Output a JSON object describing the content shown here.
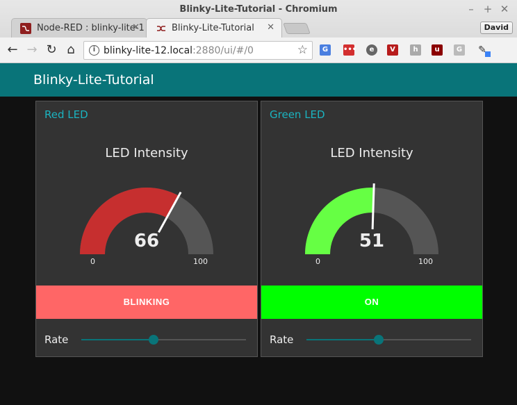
{
  "browser": {
    "window_title": "Blinky-Lite-Tutorial - Chromium",
    "tabs": [
      {
        "label": "Node-RED : blinky-lite-1"
      },
      {
        "label": "Blinky-Lite-Tutorial"
      }
    ],
    "profile_name": "David",
    "url_host": "blinky-lite-12.local",
    "url_path": ":2880/ui/#/0",
    "extensions": [
      "g-translate-icon",
      "lastpass-icon",
      "evernote-icon",
      "vivaldi-icon",
      "h-icon",
      "ublock-icon",
      "g-icon",
      "eyedropper-icon"
    ]
  },
  "dashboard": {
    "title": "Blinky-Lite-Tutorial",
    "theme": {
      "header": "#097479",
      "bg": "#111111",
      "card": "#333333",
      "accent": "#1bb3c0"
    },
    "groups": [
      {
        "name": "Red LED",
        "gauge_title": "LED Intensity",
        "value": 66,
        "value_text": "66",
        "min": "0",
        "max": "100",
        "gauge_color": "#c62f2f",
        "state_label": "BLINKING",
        "state_color": "#ff6666",
        "rate_label": "Rate",
        "rate_fraction": 0.44
      },
      {
        "name": "Green LED",
        "gauge_title": "LED Intensity",
        "value": 51,
        "value_text": "51",
        "min": "0",
        "max": "100",
        "gauge_color": "#66ff44",
        "state_label": "ON",
        "state_color": "#00ff00",
        "rate_label": "Rate",
        "rate_fraction": 0.44
      }
    ]
  }
}
